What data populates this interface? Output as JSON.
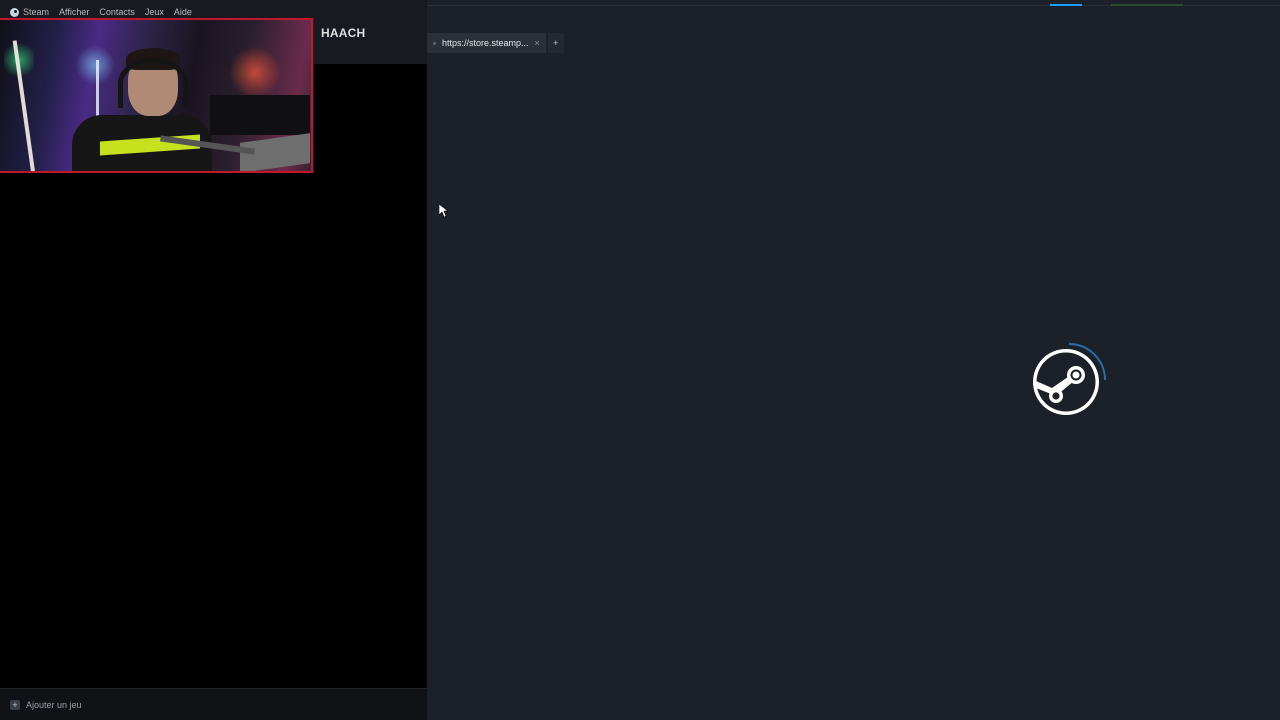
{
  "menu": {
    "items": [
      "Steam",
      "Afficher",
      "Contacts",
      "Jeux",
      "Aide"
    ]
  },
  "profile": {
    "name": "HAACH"
  },
  "browser": {
    "tab_url": "https://store.steamp...",
    "tab_close": "×",
    "new_tab": "+"
  },
  "footer": {
    "add_game_label": "Ajouter un jeu",
    "add_icon": "+"
  },
  "colors": {
    "accent": "#1a9fff",
    "webcam_border": "#c0182a",
    "panel_bg": "#000000",
    "content_bg": "#1b2029"
  },
  "icons": {
    "steam_logo": "steam-logo-icon",
    "loading": "loading-spinner-icon",
    "cursor": "mouse-cursor-icon"
  }
}
